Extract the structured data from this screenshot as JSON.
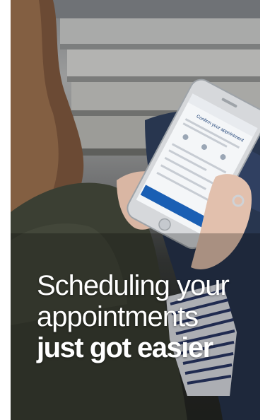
{
  "headline": {
    "line1": "Scheduling your",
    "line2": "appointments",
    "line3": "just got easier"
  },
  "phone_screen": {
    "heading": "Confirm your appointment"
  },
  "colors": {
    "accent": "#1a5fb4",
    "text": "#ffffff"
  }
}
